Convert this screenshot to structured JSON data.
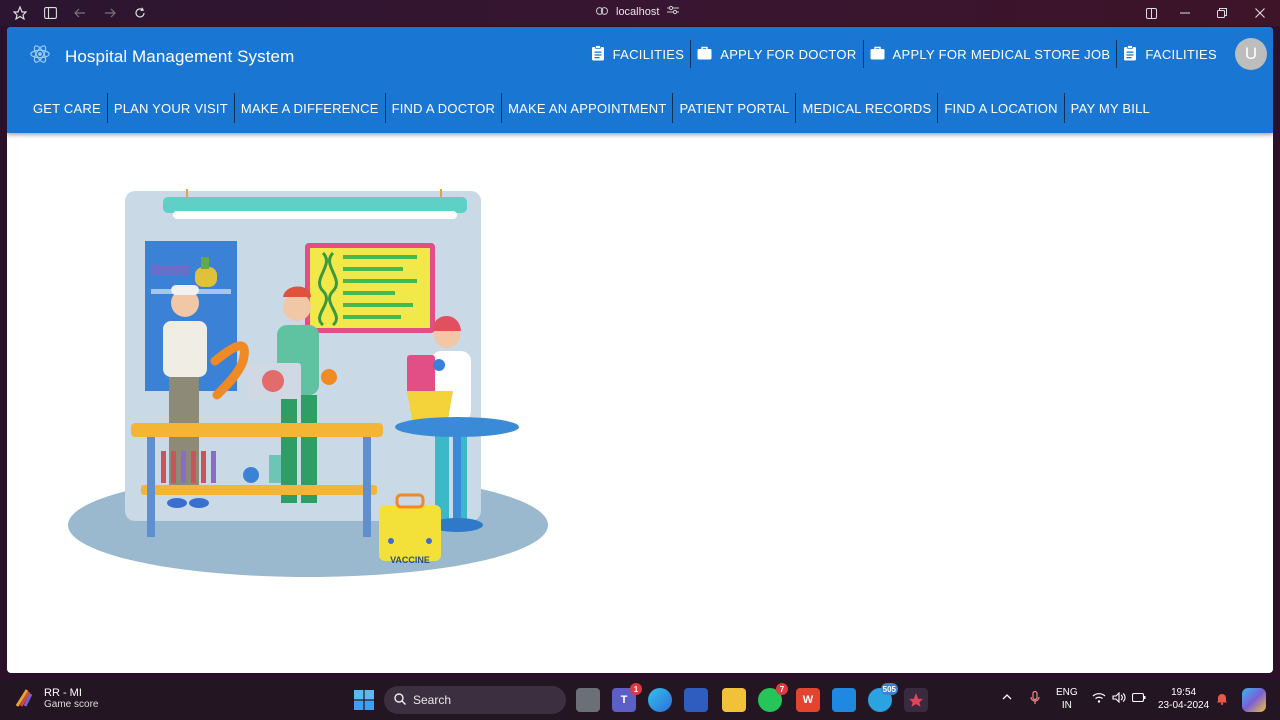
{
  "browser": {
    "url": "localhost"
  },
  "app": {
    "title": "Hospital Management System",
    "colors": {
      "primary": "#1976d2",
      "avatar": "#bdbdbd"
    },
    "top_links": [
      {
        "label": "FACILITIES",
        "icon": "clipboard-icon"
      },
      {
        "label": "APPLY FOR DOCTOR",
        "icon": "briefcase-icon"
      },
      {
        "label": "APPLY FOR MEDICAL STORE JOB",
        "icon": "briefcase-icon"
      },
      {
        "label": "FACILITIES",
        "icon": "clipboard-icon"
      }
    ],
    "avatar_letter": "U",
    "menu": [
      "GET CARE",
      "PLAN YOUR VISIT",
      "MAKE A DIFFERENCE",
      "FIND A DOCTOR",
      "MAKE AN APPOINTMENT",
      "PATIENT PORTAL",
      "MEDICAL RECORDS",
      "FIND A LOCATION",
      "PAY MY BILL"
    ],
    "hero": {
      "vaccine_label": "VACCINE"
    }
  },
  "taskbar": {
    "widget_title": "RR - MI",
    "widget_subtitle": "Game score",
    "search_placeholder": "Search",
    "badges": {
      "teams": "1",
      "whatsapp": "7",
      "telegram": "505"
    },
    "lang_line1": "ENG",
    "lang_line2": "IN",
    "time": "19:54",
    "date": "23-04-2024"
  }
}
